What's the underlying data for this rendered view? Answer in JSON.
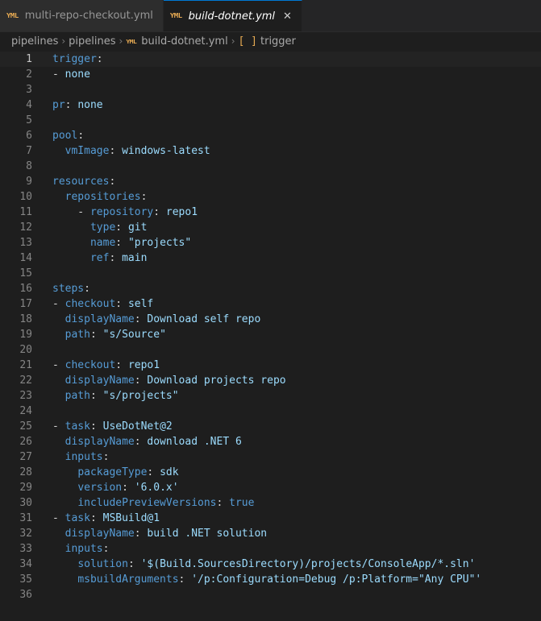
{
  "tabs": [
    {
      "label": "multi-repo-checkout.yml",
      "active": false
    },
    {
      "label": "build-dotnet.yml",
      "active": true
    }
  ],
  "breadcrumb": [
    "pipelines",
    "pipelines",
    "build-dotnet.yml",
    "trigger"
  ],
  "icons": {
    "yml": "yml-file-icon",
    "close": "close-icon",
    "symbol": "array-bracket-icon"
  },
  "current_line": 1,
  "lines": [
    [
      [
        "k",
        "trigger"
      ],
      [
        "p",
        ":"
      ]
    ],
    [
      [
        "p",
        "- "
      ],
      [
        "v",
        "none"
      ]
    ],
    [],
    [
      [
        "k",
        "pr"
      ],
      [
        "p",
        ": "
      ],
      [
        "v",
        "none"
      ]
    ],
    [],
    [
      [
        "k",
        "pool"
      ],
      [
        "p",
        ":"
      ]
    ],
    [
      [
        "p",
        "  "
      ],
      [
        "k",
        "vmImage"
      ],
      [
        "p",
        ": "
      ],
      [
        "v",
        "windows-latest"
      ]
    ],
    [],
    [
      [
        "k",
        "resources"
      ],
      [
        "p",
        ":"
      ]
    ],
    [
      [
        "p",
        "  "
      ],
      [
        "k",
        "repositories"
      ],
      [
        "p",
        ":"
      ]
    ],
    [
      [
        "p",
        "    - "
      ],
      [
        "k",
        "repository"
      ],
      [
        "p",
        ": "
      ],
      [
        "v",
        "repo1"
      ]
    ],
    [
      [
        "p",
        "      "
      ],
      [
        "k",
        "type"
      ],
      [
        "p",
        ": "
      ],
      [
        "v",
        "git"
      ]
    ],
    [
      [
        "p",
        "      "
      ],
      [
        "k",
        "name"
      ],
      [
        "p",
        ": "
      ],
      [
        "v",
        "\"projects\""
      ]
    ],
    [
      [
        "p",
        "      "
      ],
      [
        "k",
        "ref"
      ],
      [
        "p",
        ": "
      ],
      [
        "v",
        "main"
      ]
    ],
    [],
    [
      [
        "k",
        "steps"
      ],
      [
        "p",
        ":"
      ]
    ],
    [
      [
        "p",
        "- "
      ],
      [
        "k",
        "checkout"
      ],
      [
        "p",
        ": "
      ],
      [
        "v",
        "self"
      ]
    ],
    [
      [
        "p",
        "  "
      ],
      [
        "k",
        "displayName"
      ],
      [
        "p",
        ": "
      ],
      [
        "v",
        "Download self repo"
      ]
    ],
    [
      [
        "p",
        "  "
      ],
      [
        "k",
        "path"
      ],
      [
        "p",
        ": "
      ],
      [
        "v",
        "\"s/Source\""
      ]
    ],
    [],
    [
      [
        "p",
        "- "
      ],
      [
        "k",
        "checkout"
      ],
      [
        "p",
        ": "
      ],
      [
        "v",
        "repo1"
      ]
    ],
    [
      [
        "p",
        "  "
      ],
      [
        "k",
        "displayName"
      ],
      [
        "p",
        ": "
      ],
      [
        "v",
        "Download projects repo"
      ]
    ],
    [
      [
        "p",
        "  "
      ],
      [
        "k",
        "path"
      ],
      [
        "p",
        ": "
      ],
      [
        "v",
        "\"s/projects\""
      ]
    ],
    [],
    [
      [
        "p",
        "- "
      ],
      [
        "k",
        "task"
      ],
      [
        "p",
        ": "
      ],
      [
        "v",
        "UseDotNet@2"
      ]
    ],
    [
      [
        "p",
        "  "
      ],
      [
        "k",
        "displayName"
      ],
      [
        "p",
        ": "
      ],
      [
        "v",
        "download .NET 6"
      ]
    ],
    [
      [
        "p",
        "  "
      ],
      [
        "k",
        "inputs"
      ],
      [
        "p",
        ":"
      ]
    ],
    [
      [
        "p",
        "    "
      ],
      [
        "k",
        "packageType"
      ],
      [
        "p",
        ": "
      ],
      [
        "v",
        "sdk"
      ]
    ],
    [
      [
        "p",
        "    "
      ],
      [
        "k",
        "version"
      ],
      [
        "p",
        ": "
      ],
      [
        "v",
        "'6.0.x'"
      ]
    ],
    [
      [
        "p",
        "    "
      ],
      [
        "k",
        "includePreviewVersions"
      ],
      [
        "p",
        ": "
      ],
      [
        "b",
        "true"
      ]
    ],
    [
      [
        "p",
        "- "
      ],
      [
        "k",
        "task"
      ],
      [
        "p",
        ": "
      ],
      [
        "v",
        "MSBuild@1"
      ]
    ],
    [
      [
        "p",
        "  "
      ],
      [
        "k",
        "displayName"
      ],
      [
        "p",
        ": "
      ],
      [
        "v",
        "build .NET solution"
      ]
    ],
    [
      [
        "p",
        "  "
      ],
      [
        "k",
        "inputs"
      ],
      [
        "p",
        ":"
      ]
    ],
    [
      [
        "p",
        "    "
      ],
      [
        "k",
        "solution"
      ],
      [
        "p",
        ": "
      ],
      [
        "v",
        "'$(Build.SourcesDirectory)/projects/ConsoleApp/*.sln'"
      ]
    ],
    [
      [
        "p",
        "    "
      ],
      [
        "k",
        "msbuildArguments"
      ],
      [
        "p",
        ": "
      ],
      [
        "v",
        "'/p:Configuration=Debug /p:Platform=\"Any CPU\"'"
      ]
    ],
    []
  ]
}
